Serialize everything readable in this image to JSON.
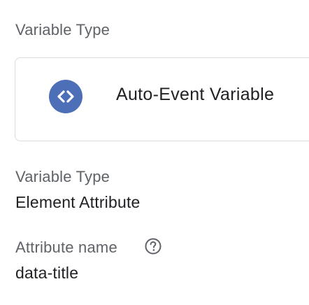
{
  "section": {
    "heading": "Variable Type"
  },
  "variable_type_card": {
    "icon": "code-brackets-icon",
    "name": "Auto-Event Variable"
  },
  "fields": {
    "variable_type": {
      "label": "Variable Type",
      "value": "Element Attribute"
    },
    "attribute_name": {
      "label": "Attribute name",
      "help_icon": "help-circle-icon",
      "value": "data-title"
    }
  },
  "colors": {
    "icon_background": "#4c6fb8",
    "label_text": "#5f6368",
    "value_text": "#202124",
    "card_border": "#dadce0"
  }
}
